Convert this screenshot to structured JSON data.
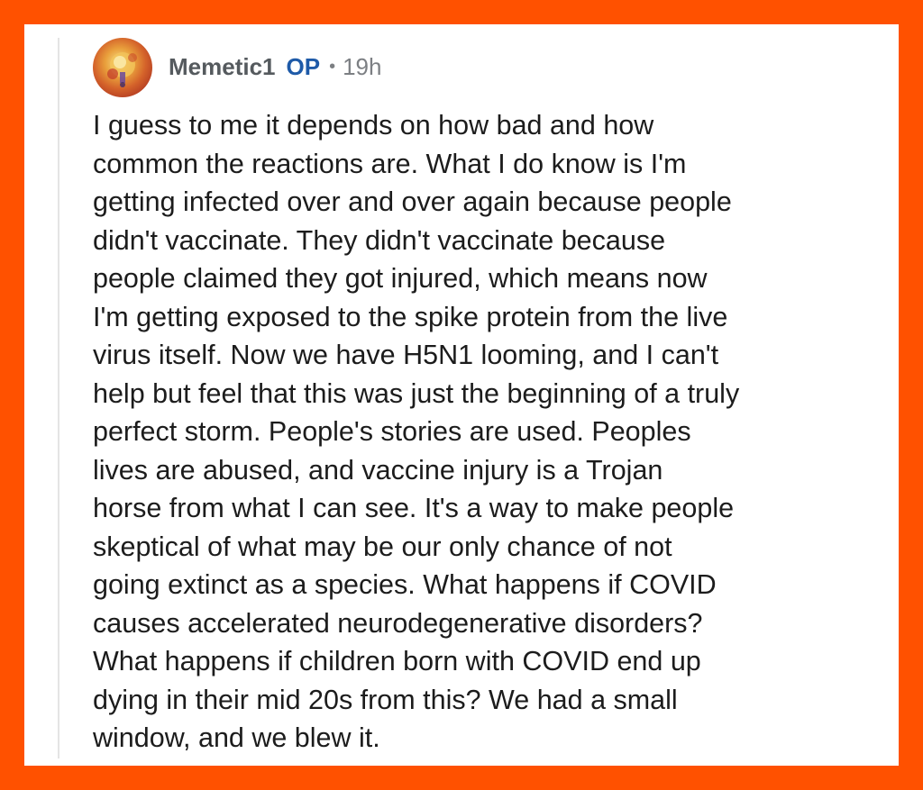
{
  "comment": {
    "username": "Memetic1",
    "op_badge": "OP",
    "separator": "•",
    "timestamp": "19h",
    "avatar_icon": "user-avatar-icon",
    "body_lines": [
      "I guess to me it depends on how bad and how",
      "common the reactions are. What I do know is I'm",
      "getting infected over and over again because people",
      "didn't vaccinate. They didn't vaccinate because",
      "people claimed they got injured, which means now",
      "I'm getting exposed to the spike protein from the live",
      "virus itself. Now we have H5N1 looming, and I can't",
      "help but feel that this was just the beginning of a truly",
      "perfect storm. People's stories are used. Peoples",
      "lives are abused, and vaccine injury is a Trojan",
      "horse from what I can see. It's a way to make people",
      "skeptical of what may be our only chance of not",
      "going extinct as a species. What happens if COVID",
      "causes accelerated neurodegenerative disorders?",
      "What happens if children born with COVID end up",
      "dying in their mid 20s from this? We had a small",
      "window, and we blew it."
    ]
  },
  "colors": {
    "frame": "#ff5100",
    "card": "#ffffff",
    "op_badge": "#1e5aa8",
    "username": "#555a5e",
    "meta": "#7c7f83",
    "body_text": "#1c1c1c"
  }
}
